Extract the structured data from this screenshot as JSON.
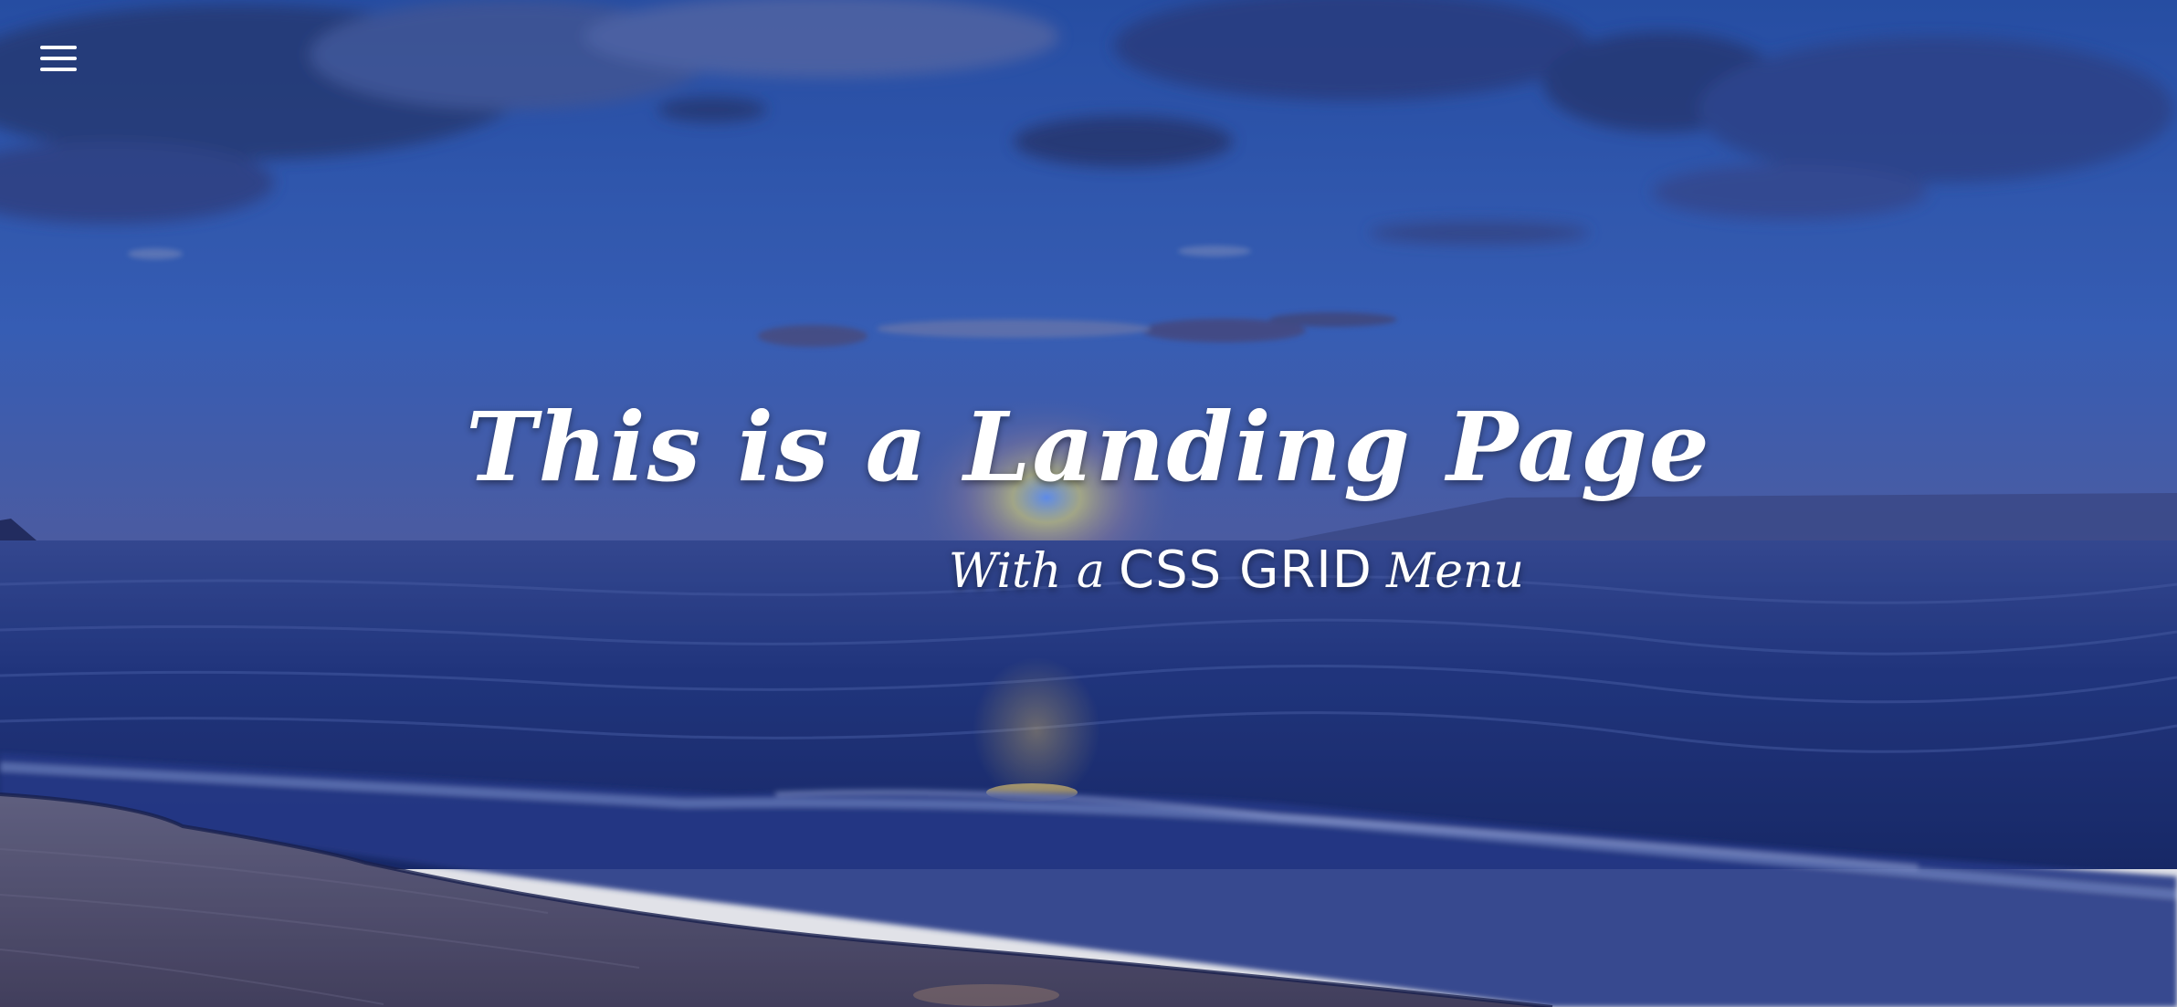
{
  "menu": {
    "icon": "hamburger-icon"
  },
  "hero": {
    "title": "This is a Landing Page",
    "subtitle_prefix": "With a",
    "subtitle_highlight": "CSS GRID",
    "subtitle_suffix": "Menu"
  },
  "colors": {
    "sky_top": "#2f5fb8",
    "sky_horizon": "#4f69b3",
    "sea": "#1e3378",
    "sand": "#5a5876",
    "sun_glow": "#d8c57a",
    "text": "#ffffff"
  }
}
